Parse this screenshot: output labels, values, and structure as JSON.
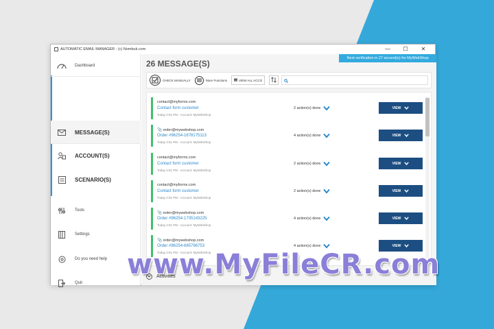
{
  "window": {
    "title": "AUTOMATIC EMAIL MANAGER - (c) Nombuk.com",
    "minimize": "—",
    "maximize": "☐",
    "close": "✕"
  },
  "sidebar": {
    "dashboard": "Dashboard",
    "messages": "MESSAGE(S)",
    "accounts": "ACCOUNT(S)",
    "scenarios": "SCENARIO(S)",
    "tools": "Tools",
    "settings": "Settings",
    "help": "Do you need help",
    "quit": "Quit"
  },
  "header": {
    "title": "26 MESSAGE(S)",
    "notification": "Next verification in 27 second(s) for MyWebShop"
  },
  "toolbar": {
    "check_manually": "CHECK MANUALLY",
    "more_functions": "More Functions",
    "view_all_accounts": "VIEW ALL ACCO",
    "search_placeholder": ""
  },
  "messages": [
    {
      "from": "contact@myforms.com",
      "subject": "Contact form customer",
      "meta": "Today 2:51 PM - Account: MyWebShop",
      "actions": "2 action(s) done",
      "view": "VIEW",
      "attachment": false
    },
    {
      "from": "order@mywebshop.com",
      "subject": "Order #96254-1678175113",
      "meta": "Today 2:51 PM - Account: MyWebShop",
      "actions": "4 action(s) done",
      "view": "VIEW",
      "attachment": true
    },
    {
      "from": "contact@myforms.com",
      "subject": "Contact form customer",
      "meta": "Today 2:51 PM - Account: MyWebShop",
      "actions": "2 action(s) done",
      "view": "VIEW",
      "attachment": false
    },
    {
      "from": "contact@myforms.com",
      "subject": "Contact form customer",
      "meta": "Today 2:51 PM - Account: MyWebShop",
      "actions": "2 action(s) done",
      "view": "VIEW",
      "attachment": false
    },
    {
      "from": "order@mywebshop.com",
      "subject": "Order #96254-1705143225",
      "meta": "Today 2:51 PM - Account: MyWebShop",
      "actions": "4 action(s) done",
      "view": "VIEW",
      "attachment": true
    },
    {
      "from": "order@mywebshop.com",
      "subject": "Order #96254-685796753",
      "meta": "Today 2:51 PM - Account: MyWebShop",
      "actions": "4 action(s) done",
      "view": "VIEW",
      "attachment": true
    }
  ],
  "activities": {
    "label": "Activities"
  },
  "watermark": "www.MyFileCR.com",
  "colors": {
    "accent": "#2196f3",
    "view_button": "#1c4e82",
    "message_border": "#3fbf6b",
    "notify": "#33aade",
    "link": "#2b89c8"
  }
}
